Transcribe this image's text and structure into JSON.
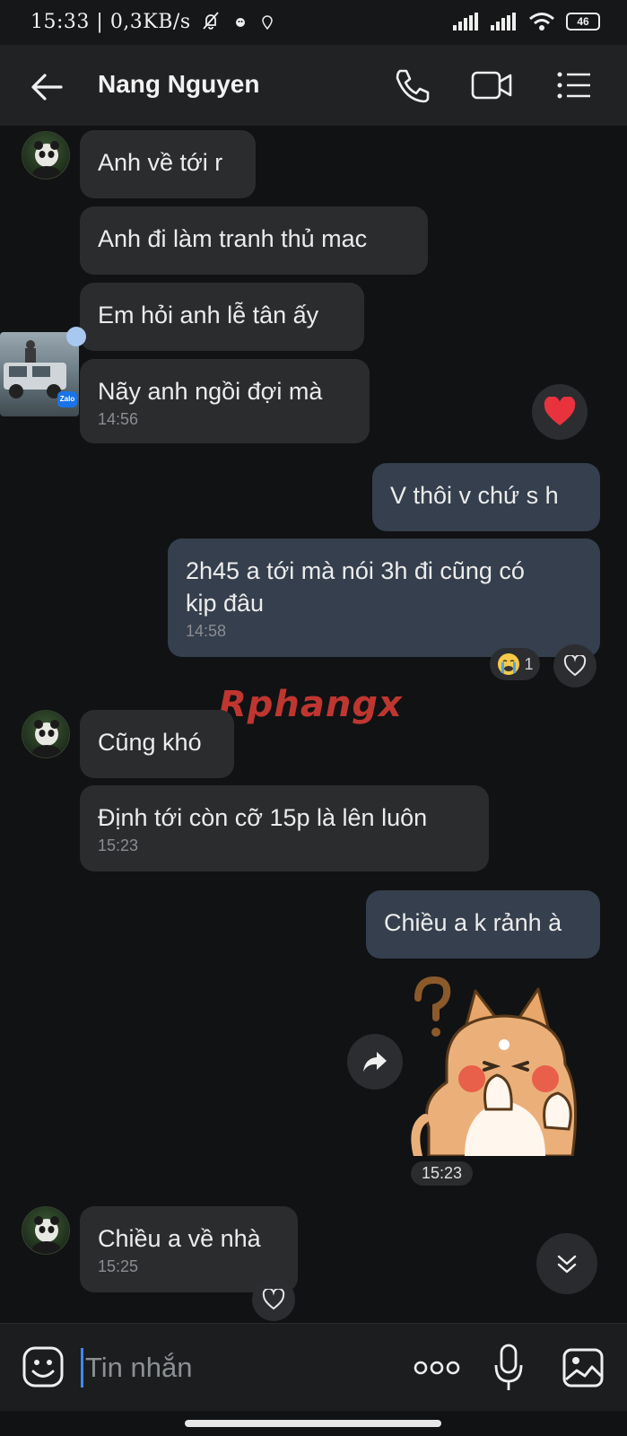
{
  "status_bar": {
    "time": "15:33",
    "net_speed": "0,3KB/s",
    "battery": "46"
  },
  "header": {
    "title": "Nang Nguyen"
  },
  "messages": [
    {
      "text": "Anh về tới r"
    },
    {
      "text": "Anh đi làm tranh thủ mac"
    },
    {
      "text": "Em hỏi anh lễ tân ấy"
    },
    {
      "text": "Nãy anh ngồi đợi mà",
      "time": "14:56"
    },
    {
      "text": "V thôi v chứ s h"
    },
    {
      "line1": "2h45 a tới mà nói 3h đi cũng có",
      "line2": "kịp đâu",
      "time": "14:58",
      "reaction_count": "1"
    },
    {
      "text": "Cũng khó"
    },
    {
      "text": "Định tới còn cỡ 15p là lên luôn",
      "time": "15:23"
    },
    {
      "text": "Chiều a k rảnh à"
    },
    {
      "sticker_time": "15:23"
    },
    {
      "text": "Chiều a về nhà",
      "time": "15:25"
    }
  ],
  "watermark": "Rphangx",
  "floating_badge": "Zalo",
  "input": {
    "placeholder": "Tin nhắn"
  },
  "colors": {
    "background": "#111214",
    "incoming_bubble": "#2b2c2e",
    "outgoing_bubble": "#353f4d",
    "accent": "#3b8cf0",
    "heart": "#e8333f"
  }
}
